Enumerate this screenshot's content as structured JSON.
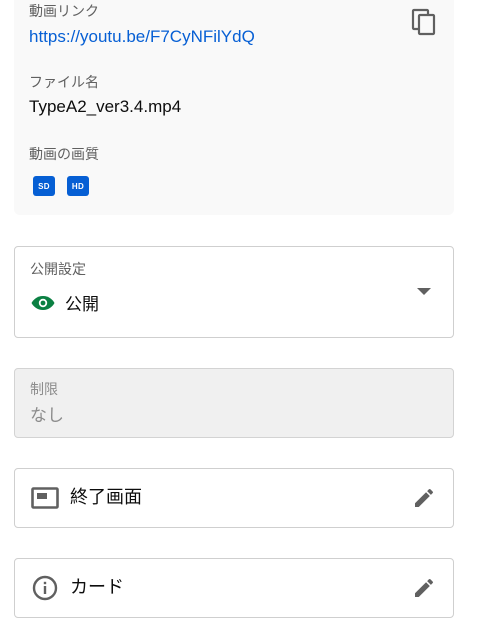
{
  "info_card": {
    "video_link_label": "動画リンク",
    "video_link_url": "https://youtu.be/F7CyNFilYdQ",
    "file_name_label": "ファイル名",
    "file_name": "TypeA2_ver3.4.mp4",
    "quality_label": "動画の画質",
    "quality_badges": [
      "SD",
      "HD"
    ],
    "copy_icon": "copy-icon"
  },
  "visibility": {
    "label": "公開設定",
    "value": "公開",
    "icon": "eye-icon",
    "status_color": "#0b8043"
  },
  "restriction": {
    "label": "制限",
    "value": "なし"
  },
  "end_screen": {
    "label": "終了画面",
    "icon": "end-screen-icon",
    "action_icon": "pencil-icon"
  },
  "cards": {
    "label": "カード",
    "icon": "info-icon",
    "action_icon": "pencil-icon"
  },
  "colors": {
    "accent": "#065fd4",
    "icon_gray": "#606060"
  }
}
